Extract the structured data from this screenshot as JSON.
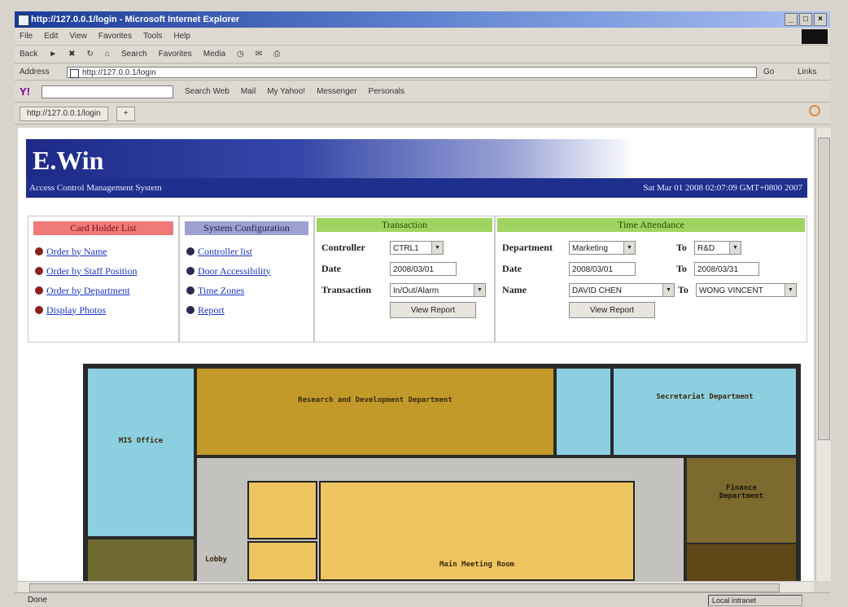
{
  "browser": {
    "window_title": "http://127.0.0.1/login - Microsoft Internet Explorer",
    "menu": [
      "File",
      "Edit",
      "View",
      "Favorites",
      "Tools",
      "Help"
    ],
    "nav_buttons": [
      "Back",
      "Search",
      "Favorites",
      "Media"
    ],
    "address_label": "Address",
    "address_value": "http://127.0.0.1/login",
    "go_label": "Go",
    "links_label": "Links",
    "yahoo_items": [
      "Search Web",
      "Mail",
      "My Yahoo!",
      "Messenger",
      "Personals"
    ],
    "tab_title": "http://127.0.0.1/login",
    "status_text": "Done",
    "zone_text": "Local intranet"
  },
  "app": {
    "logo": "E.Win",
    "subtitle": "Access Control Management System",
    "datetime": "Sat Mar 01 2008 02:07:09 GMT+0800 2007"
  },
  "panels": {
    "card_holder": {
      "title": "Card Holder List",
      "links": [
        "Order by Name",
        "Order by Staff Position",
        "Order by Department",
        "Display Photos"
      ]
    },
    "system_config": {
      "title": "System Configuration",
      "links": [
        "Controller list",
        "Door Accessibility",
        "Time Zones",
        "Report"
      ]
    },
    "transaction": {
      "title": "Transaction",
      "controller_label": "Controller",
      "controller_value": "CTRL1",
      "date_label": "Date",
      "date_value": "2008/03/01",
      "transaction_label": "Transaction",
      "transaction_value": "In/Out/Alarm",
      "view_report": "View Report"
    },
    "attendance": {
      "title": "Time Attendance",
      "department_label": "Department",
      "department_value": "Marketing",
      "to_label": "To",
      "dept_to_value": "R&D",
      "date_label": "Date",
      "date_value": "2008/03/01",
      "date_to_value": "2008/03/31",
      "name_label": "Name",
      "name_value": "DAVID CHEN",
      "name_to_value": "WONG VINCENT",
      "view_report": "View Report"
    }
  },
  "floorplan": {
    "rooms": {
      "rnd": "Research and Development Department",
      "mis": "MIS Office",
      "secretariat": "Secretariat Department",
      "finance": "Finance Department",
      "lobby": "Lobby",
      "meeting": "Main Meeting Room"
    }
  }
}
